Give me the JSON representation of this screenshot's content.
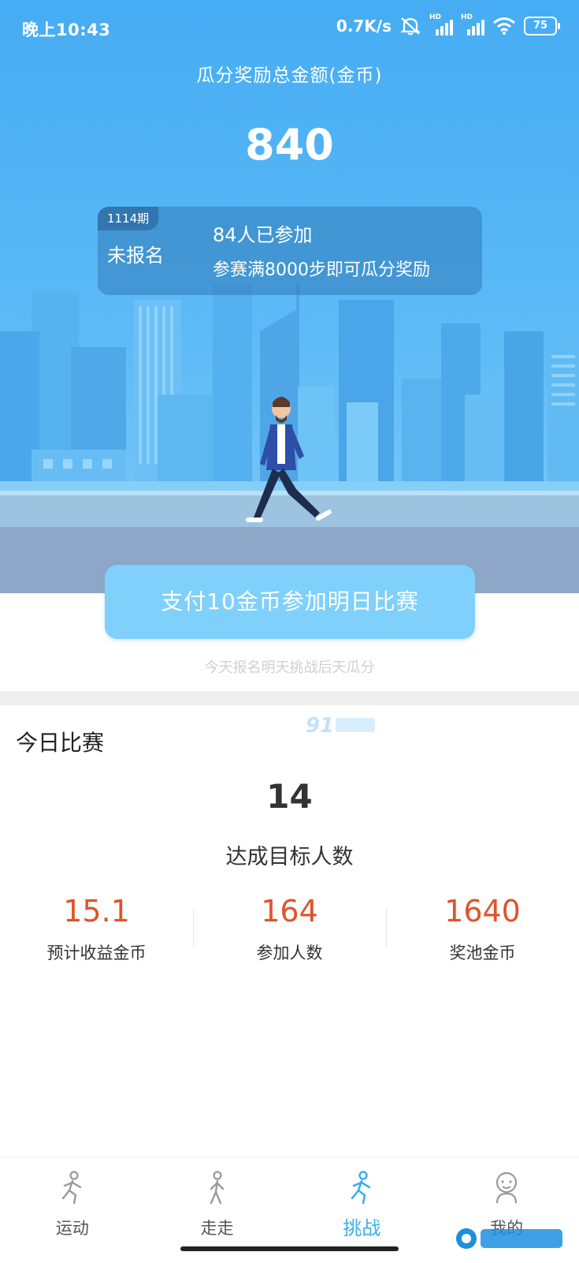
{
  "status_bar": {
    "time": "晚上10:43",
    "net_speed": "0.7K/s",
    "sig1": "HD",
    "sig2": "HD",
    "battery": "75"
  },
  "hero": {
    "pool_title": "瓜分奖励总金额(金币)",
    "pool_amount": "840",
    "period": "1114期",
    "registration_status": "未报名",
    "participants": "84人已参加",
    "rule": "参赛满8000步即可瓜分奖励"
  },
  "actions": {
    "pay_button": "支付10金币参加明日比赛",
    "schedule_hint": "今天报名明天挑战后天瓜分"
  },
  "today": {
    "title": "今日比赛",
    "achieved_count": "14",
    "achieved_label": "达成目标人数",
    "stats": [
      {
        "value": "15.1",
        "label": "预计收益金币"
      },
      {
        "value": "164",
        "label": "参加人数"
      },
      {
        "value": "1640",
        "label": "奖池金币"
      }
    ]
  },
  "tabs": [
    {
      "label": "运动"
    },
    {
      "label": "走走"
    },
    {
      "label": "挑战"
    },
    {
      "label": "我的"
    }
  ],
  "colors": {
    "accent": "#3aaeea",
    "stat_value": "#e0532a",
    "hero_bg": "#46acf3"
  },
  "icons": [
    "mute-icon",
    "signal-icon",
    "wifi-icon",
    "battery-icon",
    "run-icon",
    "walk-icon",
    "challenge-icon",
    "profile-icon"
  ]
}
